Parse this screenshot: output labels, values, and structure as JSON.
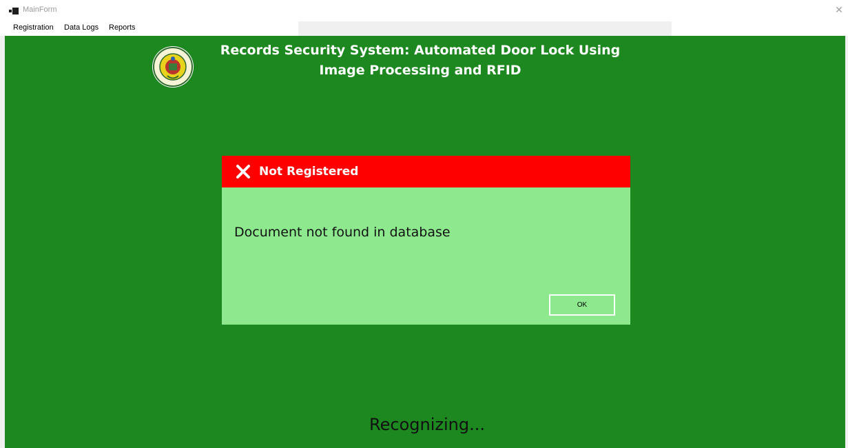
{
  "window": {
    "title": "MainForm",
    "close_glyph": "✕"
  },
  "menu": {
    "items": [
      {
        "label": "Registration"
      },
      {
        "label": "Data Logs"
      },
      {
        "label": "Reports"
      }
    ]
  },
  "header": {
    "title_line1": "Records Security System: Automated Door Lock Using",
    "title_line2": "Image Processing and RFID",
    "logo_icon": "seal-logo"
  },
  "dialog": {
    "title": "Not Registered",
    "message": "Document not found in database",
    "ok_label": "OK",
    "icon": "close-x-icon"
  },
  "status": {
    "text": "Recognizing..."
  },
  "colors": {
    "main_background": "#1e8820",
    "dialog_header": "#ff0000",
    "dialog_body": "#8ee98e"
  }
}
